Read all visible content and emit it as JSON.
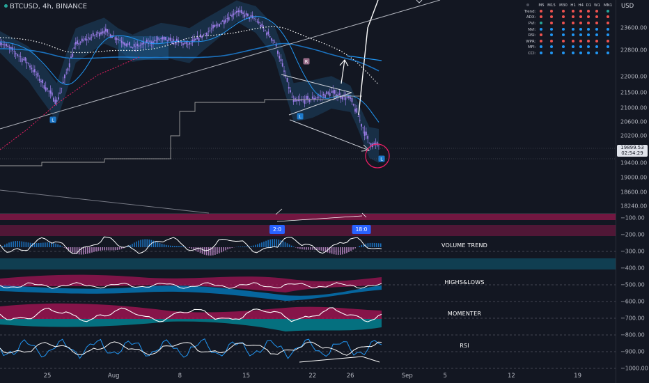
{
  "header": {
    "symbol": "BTCUSD",
    "interval": "4h",
    "exchange": "BINANCE",
    "title_text": "BTCUSD, 4h, BINANCE",
    "currency": "USD"
  },
  "price_axis": {
    "ticks": [
      "23600.00",
      "22800.00",
      "22000.00",
      "21500.00",
      "21000.00",
      "20600.00",
      "20200.00",
      "19400.00",
      "19000.00",
      "18600.00",
      "18240.00"
    ],
    "current_price": "19899.53",
    "countdown": "02:54:29"
  },
  "indicator_axis": {
    "ticks": [
      "-100.00",
      "-200.00",
      "-300.00",
      "-400.00",
      "-500.00",
      "-600.00",
      "-700.00",
      "-800.00",
      "-900.00",
      "-1000.00"
    ]
  },
  "time_axis": {
    "labels": [
      "25",
      "Aug",
      "8",
      "15",
      "22",
      "26",
      "Sep",
      "5",
      "12",
      "19"
    ]
  },
  "mtf_table": {
    "columns": [
      "M5",
      "M15",
      "M30",
      "H1",
      "H4",
      "D1",
      "W1",
      "MN1"
    ],
    "rows": [
      {
        "label": "Trend:",
        "cells": [
          "r",
          "r",
          "r",
          "r",
          "r",
          "r",
          "r",
          "g"
        ]
      },
      {
        "label": "ADX:",
        "cells": [
          "r",
          "r",
          "r",
          "r",
          "r",
          "r",
          "r",
          "r"
        ]
      },
      {
        "label": "PVI:",
        "cells": [
          "g",
          "r",
          "r",
          "r",
          "r",
          "r",
          "r",
          "r"
        ]
      },
      {
        "label": "NVI:",
        "cells": [
          "b",
          "b",
          "b",
          "b",
          "b",
          "b",
          "b",
          "b"
        ]
      },
      {
        "label": "RSI:",
        "cells": [
          "r",
          "b",
          "b",
          "b",
          "b",
          "b",
          "b",
          "b"
        ]
      },
      {
        "label": "WPR:",
        "cells": [
          "r",
          "r",
          "r",
          "r",
          "r",
          "r",
          "r",
          "r"
        ]
      },
      {
        "label": "MFI:",
        "cells": [
          "b",
          "b",
          "b",
          "b",
          "b",
          "b",
          "b",
          "b"
        ]
      },
      {
        "label": "CCI:",
        "cells": [
          "b",
          "b",
          "b",
          "b",
          "b",
          "b",
          "b",
          "b"
        ]
      }
    ],
    "cell_colors": {
      "r": "#ef5350",
      "g": "#26a69a",
      "b": "#2196f3"
    }
  },
  "markers": {
    "price_markers": [
      "L",
      "L",
      "L",
      "R"
    ],
    "pivot_tags": [
      "2:0",
      "18:0"
    ]
  },
  "panels": {
    "labels": [
      "VOLUME TREND",
      "HIGHS&LOWS",
      "MOMENTER",
      "RSI"
    ]
  },
  "chart_data": {
    "type": "candlestick",
    "title": "",
    "xlabel": "",
    "ylabel": "",
    "x_range": [
      "2022-07-20",
      "2022-09-23"
    ],
    "ylim": [
      17500,
      24300
    ],
    "grid": false,
    "series": [
      {
        "name": "",
        "type": "close",
        "x": [
          "2022-07-20",
          "2022-07-23",
          "2022-07-26",
          "2022-07-28",
          "2022-07-31",
          "2022-08-03",
          "2022-08-06",
          "2022-08-09",
          "2022-08-12",
          "2022-08-14",
          "2022-08-16",
          "2022-08-18",
          "2022-08-20",
          "2022-08-22",
          "2022-08-24",
          "2022-08-26",
          "2022-08-28",
          "2022-08-29"
        ],
        "y": [
          23100,
          22400,
          21200,
          23000,
          23500,
          22900,
          23200,
          23000,
          23700,
          24200,
          23900,
          23100,
          21200,
          21300,
          21500,
          21300,
          20000,
          19900
        ]
      }
    ],
    "sub_panels": [
      {
        "name": "VOLUME TREND",
        "ylim": [
          -100,
          -400
        ]
      },
      {
        "name": "HIGHS&LOWS",
        "ylim": [
          -400,
          -600
        ]
      },
      {
        "name": "MOMENTER",
        "ylim": [
          -600,
          -800
        ]
      },
      {
        "name": "RSI",
        "ylim": [
          -800,
          -1000
        ]
      }
    ]
  },
  "colors": {
    "background": "#131722",
    "candle": "#9c7de8",
    "band": "#1e4d73",
    "magenta": "#c2185b",
    "teal": "#0d6e8c",
    "blue": "#2962ff",
    "pivot_tag": "#2962ff",
    "white": "#ffffff",
    "circle": "#e91e63"
  }
}
